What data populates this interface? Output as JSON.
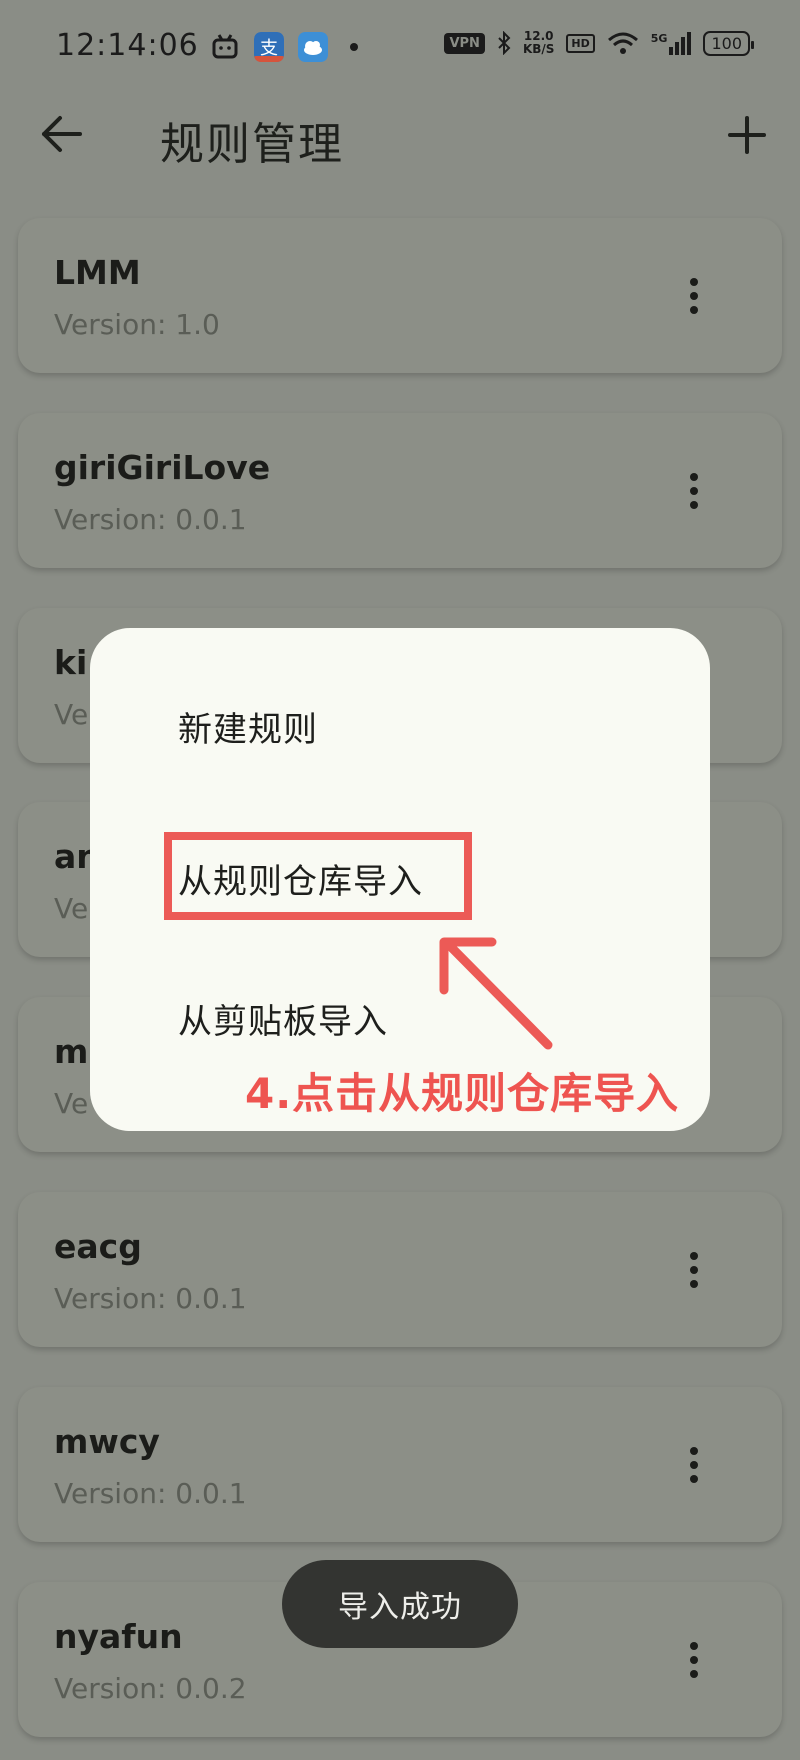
{
  "status_bar": {
    "time": "12:14:06",
    "vpn": "VPN",
    "speed_value": "12.0",
    "speed_unit": "KB/S",
    "hd": "HD",
    "signal": "5G",
    "battery": "100"
  },
  "app_bar": {
    "title": "规则管理",
    "back_icon": "arrow-back-icon",
    "add_icon": "plus-icon"
  },
  "rules": [
    {
      "name": "LMM",
      "version": "Version: 1.0"
    },
    {
      "name": "giriGiriLove",
      "version": "Version: 0.0.1"
    },
    {
      "name": "ki",
      "version": "Ve"
    },
    {
      "name": "an",
      "version": "Ve"
    },
    {
      "name": "mi",
      "version": "Ve"
    },
    {
      "name": "eacg",
      "version": "Version: 0.0.1"
    },
    {
      "name": "mwcy",
      "version": "Version: 0.0.1"
    },
    {
      "name": "nyafun",
      "version": "Version: 0.0.2"
    }
  ],
  "dialog": {
    "items": [
      {
        "label": "新建规则"
      },
      {
        "label": "从规则仓库导入"
      },
      {
        "label": "从剪贴板导入"
      }
    ]
  },
  "annotation": {
    "text": "4.点击从规则仓库导入",
    "color": "#ec5a56"
  },
  "toast": {
    "text": "导入成功"
  },
  "colors": {
    "scrim_background": "#8a8d86",
    "dialog_background": "#f9faf3",
    "annotation_red": "#ec5a56"
  }
}
